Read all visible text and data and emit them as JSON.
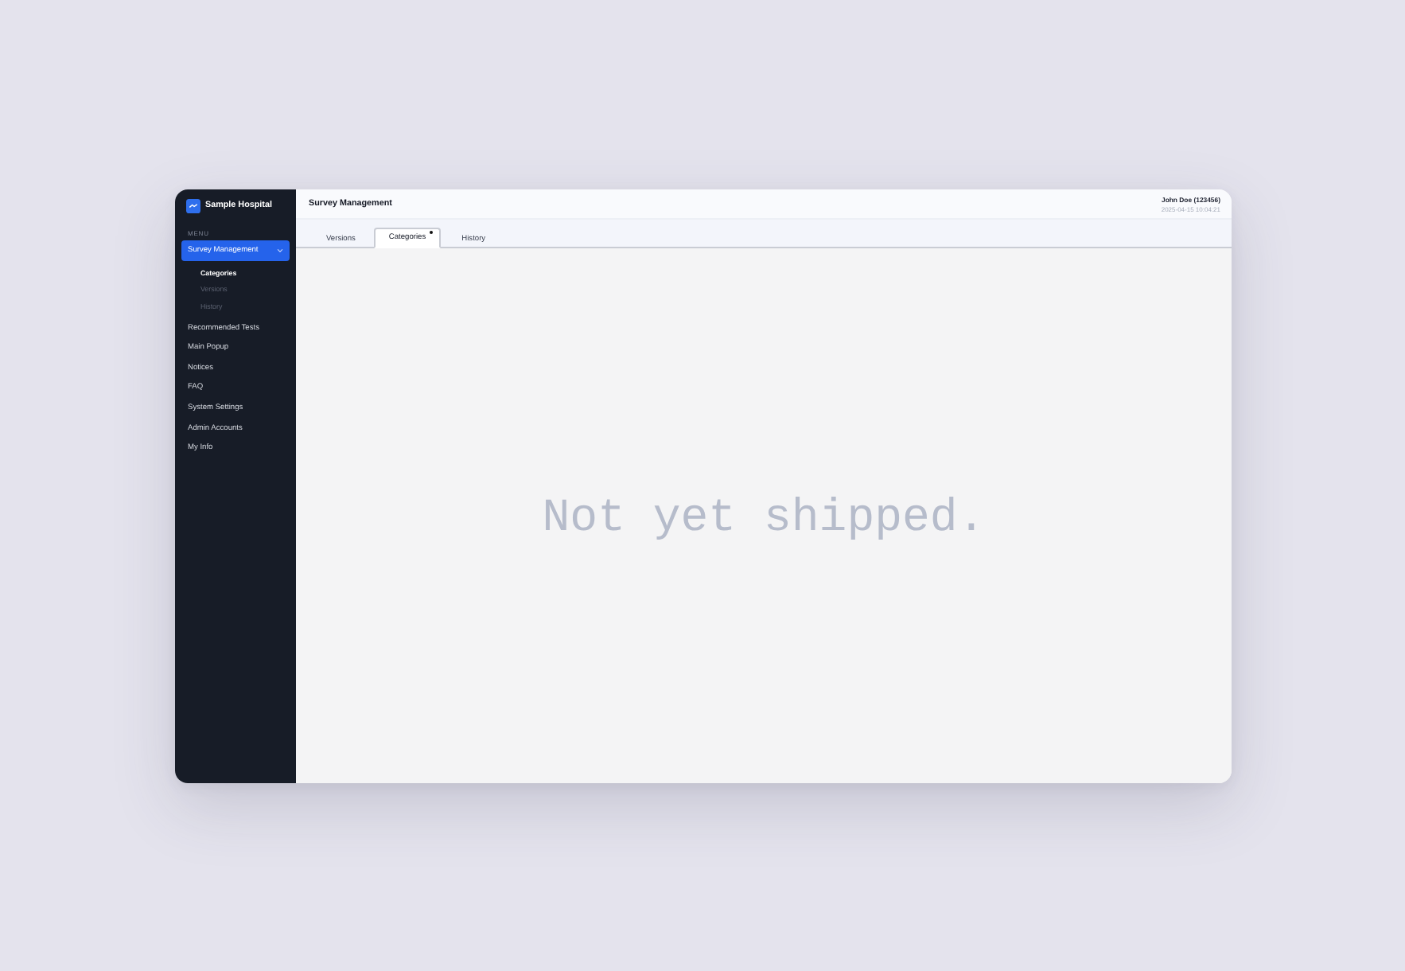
{
  "brand": {
    "name": "Sample Hospital"
  },
  "sidebar": {
    "section_label": "MENU",
    "items": [
      {
        "label": "Survey Management",
        "selected": true,
        "expanded": true,
        "children": [
          {
            "label": "Categories",
            "selected": true
          },
          {
            "label": "Versions",
            "selected": false
          },
          {
            "label": "History",
            "selected": false
          }
        ]
      },
      {
        "label": "Recommended Tests",
        "selected": false
      },
      {
        "label": "Main Popup",
        "selected": false
      },
      {
        "label": "Notices",
        "selected": false
      },
      {
        "label": "FAQ",
        "selected": false
      },
      {
        "label": "System Settings",
        "selected": false
      },
      {
        "label": "Admin Accounts",
        "selected": false
      },
      {
        "label": "My Info",
        "selected": false
      }
    ]
  },
  "header": {
    "title": "Survey Management",
    "user": "John Doe (123456)",
    "timestamp": "2025-04-15 10:04:21"
  },
  "tabs": [
    {
      "label": "Versions",
      "selected": false,
      "marked": false
    },
    {
      "label": "Categories",
      "selected": true,
      "marked": true
    },
    {
      "label": "History",
      "selected": false,
      "marked": false
    }
  ],
  "content": {
    "message": "Not yet shipped."
  }
}
